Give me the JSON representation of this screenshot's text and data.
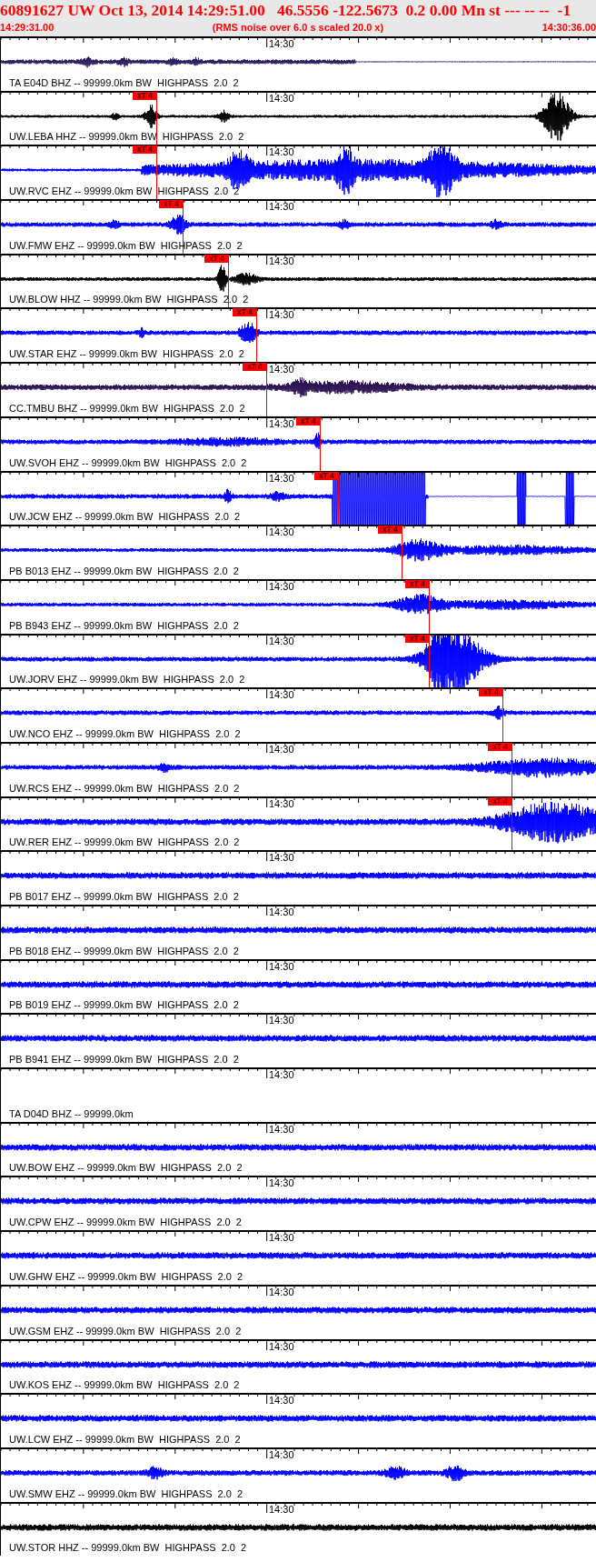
{
  "header": {
    "title": "60891627 UW Oct 13, 2014 14:29:51.00   46.5556 -122.5673  0.2 0.00 Mn st --- -- --  -1",
    "start_time": "14:29:31.00",
    "note": "(RMS noise over 6.0 s scaled 20.0 x)",
    "end_time": "14:30:36.00"
  },
  "traces": [
    {
      "kind": "waveform",
      "label": "TA E04D BHZ -- 99999.0km BW  HIGHPASS  2.0  2",
      "axis_label": "14:30",
      "color": "#2a1a5e"
    },
    {
      "kind": "waveform",
      "label": "UW.LEBA HHZ -- 99999.0km BW  HIGHPASS  2.0  2",
      "axis_label": "14:30",
      "color": "#000000",
      "pick": "xT 4"
    },
    {
      "kind": "waveform",
      "label": "UW.RVC EHZ -- 99999.0km BW  HIGHPASS  2.0  2",
      "axis_label": "14:30",
      "color": "#0000ff",
      "pick": "xT 4"
    },
    {
      "kind": "waveform",
      "label": "UW.FMW EHZ -- 99999.0km BW  HIGHPASS  2.0  2",
      "axis_label": "14:30",
      "color": "#0000ff",
      "pick": "xT 4"
    },
    {
      "kind": "waveform",
      "label": "UW.BLOW HHZ -- 99999.0km BW  HIGHPASS  2.0  2",
      "axis_label": "14:30",
      "color": "#000000",
      "pick": "xT 4"
    },
    {
      "kind": "waveform",
      "label": "UW.STAR EHZ -- 99999.0km BW  HIGHPASS  2.0  2",
      "axis_label": "14:30",
      "color": "#0000ff",
      "pick": "xT 4"
    },
    {
      "kind": "waveform",
      "label": "CC.TMBU BHZ -- 99999.0km BW  HIGHPASS  2.0  2",
      "axis_label": "14:30",
      "color": "#2a1050",
      "pick": "xT 4"
    },
    {
      "kind": "waveform",
      "label": "UW.SVOH EHZ -- 99999.0km BW  HIGHPASS  2.0  2",
      "axis_label": "14:30",
      "color": "#0000ff",
      "pick": "xT 4"
    },
    {
      "kind": "waveform",
      "label": "UW.JCW EHZ -- 99999.0km BW  HIGHPASS  2.0  2",
      "axis_label": "14:30",
      "color": "#0000ff",
      "pick": "xT 4"
    },
    {
      "kind": "waveform",
      "label": "PB B013 EHZ -- 99999.0km BW  HIGHPASS  2.0  2",
      "axis_label": "14:30",
      "color": "#0000ff",
      "pick": "xT 4"
    },
    {
      "kind": "waveform",
      "label": "PB B943 EHZ -- 99999.0km BW  HIGHPASS  2.0  2",
      "axis_label": "14:30",
      "color": "#0000ff",
      "pick": "xT 4"
    },
    {
      "kind": "waveform",
      "label": "UW.JORV EHZ -- 99999.0km BW  HIGHPASS  2.0  2",
      "axis_label": "14:30",
      "color": "#0000ff",
      "pick": "xT 4"
    },
    {
      "kind": "waveform",
      "label": "UW.NCO EHZ -- 99999.0km BW  HIGHPASS  2.0  2",
      "axis_label": "14:30",
      "color": "#0000ff",
      "pick": "xT 4"
    },
    {
      "kind": "waveform",
      "label": "UW.RCS EHZ -- 99999.0km BW  HIGHPASS  2.0  2",
      "axis_label": "14:30",
      "color": "#0000ff",
      "pick": "xT 4"
    },
    {
      "kind": "waveform",
      "label": "UW.RER EHZ -- 99999.0km BW  HIGHPASS  2.0  2",
      "axis_label": "14:30",
      "color": "#0000ff",
      "pick": "xT 4"
    },
    {
      "kind": "waveform",
      "label": "PB B017 EHZ -- 99999.0km BW  HIGHPASS  2.0  2",
      "axis_label": "14:30",
      "color": "#0000ff"
    },
    {
      "kind": "waveform",
      "label": "PB B018 EHZ -- 99999.0km BW  HIGHPASS  2.0  2",
      "axis_label": "14:30",
      "color": "#0000ff"
    },
    {
      "kind": "waveform",
      "label": "PB B019 EHZ -- 99999.0km BW  HIGHPASS  2.0  2",
      "axis_label": "14:30",
      "color": "#0000ff"
    },
    {
      "kind": "waveform",
      "label": "PB B941 EHZ -- 99999.0km BW  HIGHPASS  2.0  2",
      "axis_label": "14:30",
      "color": "#0000ff"
    },
    {
      "kind": "empty",
      "label": "TA D04D BHZ -- 99999.0km",
      "axis_label": "14:30"
    },
    {
      "kind": "waveform",
      "label": "UW.BOW EHZ -- 99999.0km BW  HIGHPASS  2.0  2",
      "axis_label": "14:30",
      "color": "#0000ff"
    },
    {
      "kind": "waveform",
      "label": "UW.CPW EHZ -- 99999.0km BW  HIGHPASS  2.0  2",
      "axis_label": "14:30",
      "color": "#0000ff"
    },
    {
      "kind": "waveform",
      "label": "UW.GHW EHZ -- 99999.0km BW  HIGHPASS  2.0  2",
      "axis_label": "14:30",
      "color": "#0000ff"
    },
    {
      "kind": "waveform",
      "label": "UW.GSM EHZ -- 99999.0km BW  HIGHPASS  2.0  2",
      "axis_label": "14:30",
      "color": "#0000ff"
    },
    {
      "kind": "waveform",
      "label": "UW.KOS EHZ -- 99999.0km BW  HIGHPASS  2.0  2",
      "axis_label": "14:30",
      "color": "#0000ff"
    },
    {
      "kind": "waveform",
      "label": "UW.LCW EHZ -- 99999.0km BW  HIGHPASS  2.0  2",
      "axis_label": "14:30",
      "color": "#0000ff"
    },
    {
      "kind": "waveform",
      "label": "UW.SMW EHZ -- 99999.0km BW  HIGHPASS  2.0  2",
      "axis_label": "14:30",
      "color": "#0000ff"
    },
    {
      "kind": "waveform",
      "label": "UW.STOR HHZ -- 99999.0km BW  HIGHPASS  2.0  2",
      "axis_label": "14:30",
      "color": "#000000"
    }
  ]
}
